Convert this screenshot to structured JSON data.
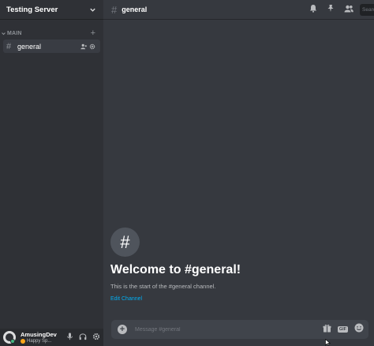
{
  "server": {
    "name": "Testing Server"
  },
  "category": {
    "label": "MAIN"
  },
  "channels": [
    {
      "name": "general",
      "selected": true
    }
  ],
  "user": {
    "name": "AmusingDev",
    "status": "Happy Sp...",
    "presence": "online"
  },
  "header": {
    "channel_name": "general",
    "search_placeholder": "Search"
  },
  "welcome": {
    "title": "Welcome to #general!",
    "subtitle": "This is the start of the #general channel.",
    "edit_link": "Edit Channel"
  },
  "composer": {
    "placeholder": "Message #general"
  },
  "colors": {
    "sidebar_bg": "#2f3136",
    "main_bg": "#36393f",
    "panel_bg": "#292b2f",
    "link": "#00aff4",
    "online": "#43b581"
  },
  "icons": [
    "chevron-down-icon",
    "plus-icon",
    "hash-icon",
    "invite-icon",
    "gear-icon",
    "microphone-icon",
    "headphones-icon",
    "bell-icon",
    "pin-icon",
    "members-icon",
    "gift-icon",
    "gif-icon",
    "emoji-icon"
  ]
}
